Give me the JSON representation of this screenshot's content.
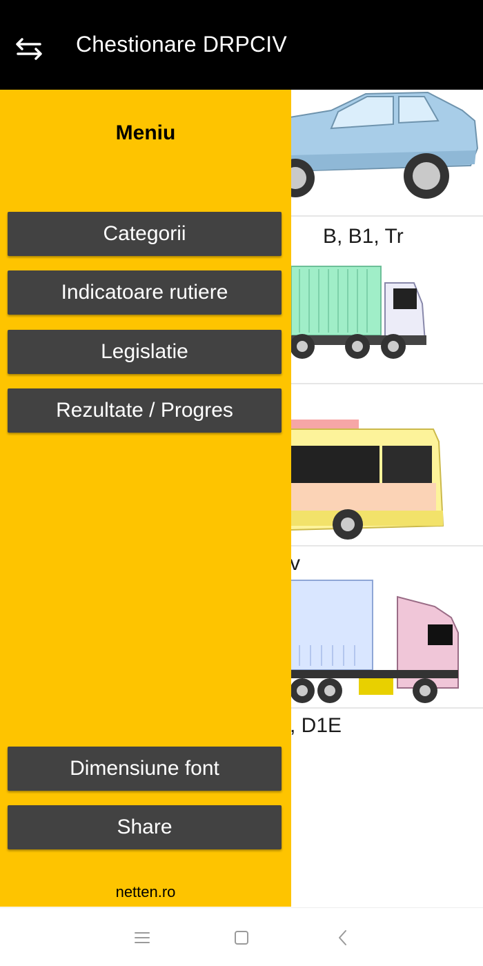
{
  "app_bar": {
    "title": "Chestionare DRPCIV",
    "left_icon": "swap-arrows-icon"
  },
  "background_cards": [
    {
      "label": "B, B1, Tr",
      "image": "car-image"
    },
    {
      "label": "",
      "image": "box-truck-image"
    },
    {
      "label": "v",
      "image": "bus-image"
    },
    {
      "label": ", D1E",
      "image": "semi-truck-image"
    }
  ],
  "drawer": {
    "title": "Meniu",
    "menu_items": [
      "Categorii",
      "Indicatoare rutiere",
      "Legislatie",
      "Rezultate / Progres"
    ],
    "bottom_items": [
      "Dimensiune font",
      "Share"
    ],
    "footer": "netten.ro",
    "background_color": "#fec400",
    "button_color": "#424242"
  },
  "nav_bar": {
    "icons": [
      "menu-lines-icon",
      "home-square-icon",
      "back-chevron-icon"
    ]
  }
}
